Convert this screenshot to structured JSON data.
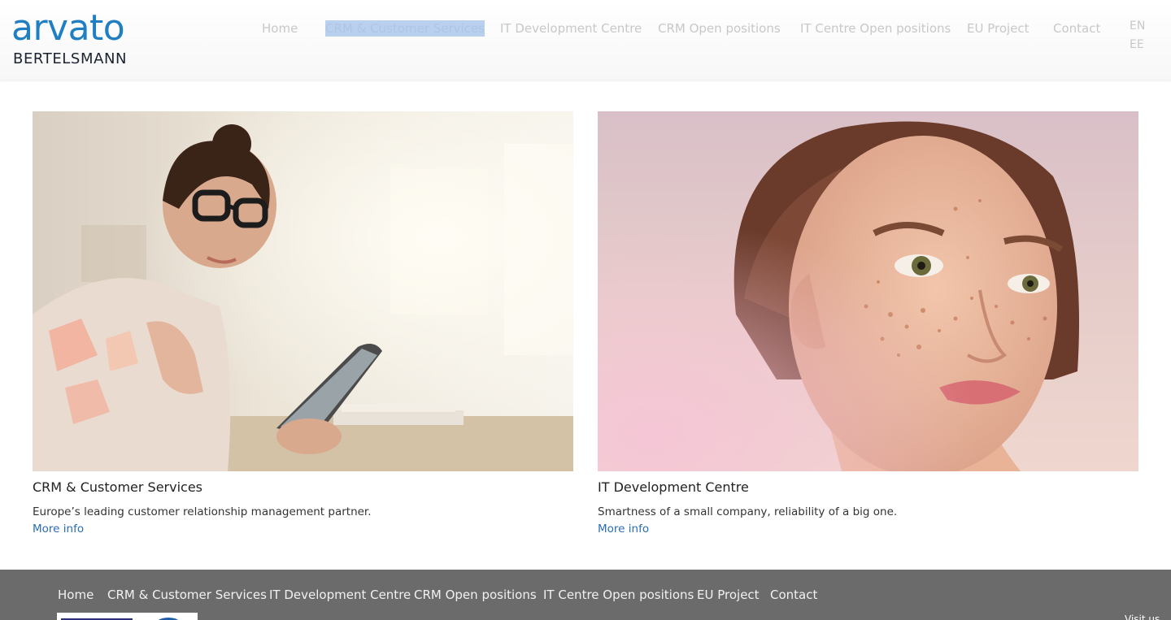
{
  "logo": {
    "main": "arvato",
    "sub": "BERTELSMANN"
  },
  "nav": {
    "items": [
      {
        "label": "Home"
      },
      {
        "label": "CRM & Customer Services",
        "selected": true
      },
      {
        "label": "IT Development Centre"
      },
      {
        "label": "CRM Open positions"
      },
      {
        "label": "IT Centre Open positions"
      },
      {
        "label": "EU Project"
      },
      {
        "label": "Contact"
      }
    ],
    "languages": [
      "EN",
      "EE"
    ]
  },
  "cards": [
    {
      "title": "CRM & Customer Services",
      "description": "Europe’s leading customer relationship management partner.",
      "link": "More info"
    },
    {
      "title": "IT Development Centre",
      "description": "Smartness of a small company, reliability of a big one.",
      "link": "More info"
    }
  ],
  "footer": {
    "items": [
      "Home",
      "CRM & Customer Services",
      "IT Development Centre",
      "CRM Open positions",
      "IT Centre Open positions",
      "EU Project",
      "Contact"
    ],
    "visit": "Visit us"
  },
  "colors": {
    "brand_blue": "#1f7fc2",
    "nav_text": "#c8c8c8",
    "selection": "#b9d1ee",
    "link": "#2a6db3",
    "footer_bg": "#6b6b6b"
  }
}
